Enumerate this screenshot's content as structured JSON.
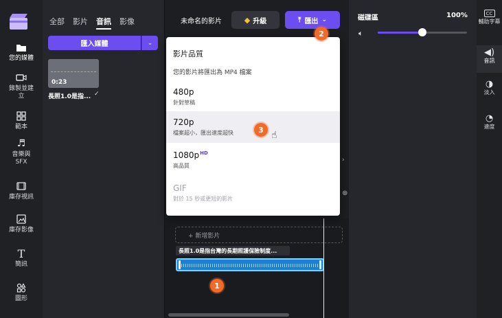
{
  "left_rail": {
    "items": [
      {
        "icon": "folder-icon",
        "label": "您的媒體"
      },
      {
        "icon": "record-icon",
        "label": "錄製並建立"
      },
      {
        "icon": "template-icon",
        "label": "範本"
      },
      {
        "icon": "music-icon",
        "label": "音樂與SFX"
      },
      {
        "icon": "stock-video-icon",
        "label": "庫存視訊"
      },
      {
        "icon": "stock-image-icon",
        "label": "庫存影像"
      },
      {
        "icon": "text-icon",
        "label": "簡訊"
      },
      {
        "icon": "shapes-icon",
        "label": "圖形"
      }
    ]
  },
  "media_panel": {
    "tabs": [
      "全部",
      "影片",
      "音訊",
      "影像"
    ],
    "active_tab": "音訊",
    "import_label": "匯入媒體",
    "item": {
      "duration": "0:23",
      "name": "長照1.0是指..."
    }
  },
  "header": {
    "project_title": "未命名的影片",
    "upgrade_label": "升級",
    "export_label": "匯出"
  },
  "export_menu": {
    "heading": "影片品質",
    "subtitle": "您的影片將匯出為 MP4 檔案",
    "options": [
      {
        "label": "480p",
        "desc": "針對草稿",
        "hd": ""
      },
      {
        "label": "720p",
        "desc": "檔案超小，匯出速度超快",
        "hd": ""
      },
      {
        "label": "1080p",
        "desc": "高品質",
        "hd": "HD"
      },
      {
        "label": "GIF",
        "desc": "對於 15 秒或更短的影片",
        "hd": ""
      }
    ]
  },
  "timeline": {
    "add_media_label": "+ 新增影片",
    "clip_title": "長照1.0是指台灣的長期照護保險制度..."
  },
  "volume_panel": {
    "title": "磁碟區",
    "percent": "100%",
    "level": 0.5
  },
  "right_rail": {
    "items": [
      {
        "icon": "captions-icon",
        "label": "輔助字幕"
      },
      {
        "icon": "audio-icon",
        "label": "音訊"
      },
      {
        "icon": "fade-icon",
        "label": "淡入"
      },
      {
        "icon": "speed-icon",
        "label": "速度"
      }
    ]
  },
  "callouts": [
    "1",
    "2",
    "3"
  ],
  "colors": {
    "accent": "#6b4df0",
    "callout": "#f06a2a",
    "clip": "#1d7fd0"
  }
}
